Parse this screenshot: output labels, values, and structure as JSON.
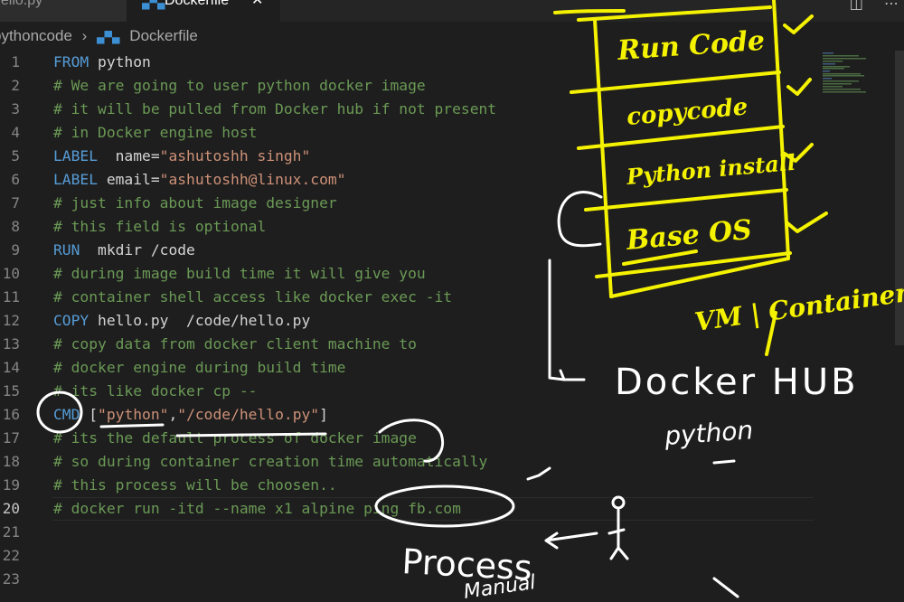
{
  "tabs": [
    {
      "label": "hello.py"
    },
    {
      "label": "Dockerfile",
      "close": "✕"
    }
  ],
  "breadcrumb": {
    "folder": "pythoncode",
    "separator": "›",
    "file": "Dockerfile"
  },
  "editor": {
    "active_line": "20",
    "lines": [
      {
        "n": "1",
        "segs": [
          {
            "t": "FROM",
            "c": "kw"
          },
          {
            "t": " python",
            "c": ""
          }
        ]
      },
      {
        "n": "2",
        "segs": [
          {
            "t": "# We are going to user python docker image",
            "c": "cm"
          }
        ]
      },
      {
        "n": "3",
        "segs": [
          {
            "t": "# it will be pulled from Docker hub if not present",
            "c": "cm"
          }
        ]
      },
      {
        "n": "4",
        "segs": [
          {
            "t": "# in Docker engine host",
            "c": "cm"
          }
        ]
      },
      {
        "n": "5",
        "segs": [
          {
            "t": "LABEL",
            "c": "kw"
          },
          {
            "t": "  name=",
            "c": ""
          },
          {
            "t": "\"ashutoshh singh\"",
            "c": "st"
          }
        ]
      },
      {
        "n": "6",
        "segs": [
          {
            "t": "LABEL",
            "c": "kw"
          },
          {
            "t": " email=",
            "c": ""
          },
          {
            "t": "\"ashutoshh@linux.com\"",
            "c": "st"
          }
        ]
      },
      {
        "n": "7",
        "segs": [
          {
            "t": "# just info about image designer",
            "c": "cm"
          }
        ]
      },
      {
        "n": "8",
        "segs": [
          {
            "t": "# this field is optional",
            "c": "cm"
          }
        ]
      },
      {
        "n": "9",
        "segs": [
          {
            "t": "RUN",
            "c": "kw"
          },
          {
            "t": "  mkdir /code",
            "c": ""
          }
        ]
      },
      {
        "n": "10",
        "segs": [
          {
            "t": "# during image build time it will give you",
            "c": "cm"
          }
        ]
      },
      {
        "n": "11",
        "segs": [
          {
            "t": "# container shell access like docker exec -it",
            "c": "cm"
          }
        ]
      },
      {
        "n": "12",
        "segs": [
          {
            "t": "COPY",
            "c": "kw"
          },
          {
            "t": " hello.py  /code/hello.py",
            "c": ""
          }
        ]
      },
      {
        "n": "13",
        "segs": [
          {
            "t": "# copy data from docker client machine to",
            "c": "cm"
          }
        ]
      },
      {
        "n": "14",
        "segs": [
          {
            "t": "# docker engine during build time",
            "c": "cm"
          }
        ]
      },
      {
        "n": "15",
        "segs": [
          {
            "t": "# its like docker cp --",
            "c": "cm"
          }
        ]
      },
      {
        "n": "16",
        "segs": [
          {
            "t": "CMD",
            "c": "kw"
          },
          {
            "t": " [",
            "c": ""
          },
          {
            "t": "\"python\"",
            "c": "st"
          },
          {
            "t": ",",
            "c": ""
          },
          {
            "t": "\"/code/hello.py\"",
            "c": "st"
          },
          {
            "t": "]",
            "c": ""
          }
        ]
      },
      {
        "n": "17",
        "segs": [
          {
            "t": "# its the default process of docker image",
            "c": "cm"
          }
        ]
      },
      {
        "n": "18",
        "segs": [
          {
            "t": "# so during container creation time automatically",
            "c": "cm"
          }
        ]
      },
      {
        "n": "19",
        "segs": [
          {
            "t": "# this process will be choosen..",
            "c": "cm"
          }
        ]
      },
      {
        "n": "20",
        "segs": [
          {
            "t": "# docker run -itd --name x1 alpine ping fb.com",
            "c": "cm"
          }
        ]
      },
      {
        "n": "21",
        "segs": []
      },
      {
        "n": "22",
        "segs": []
      },
      {
        "n": "23",
        "segs": []
      }
    ]
  },
  "annotations": {
    "layers": [
      "Run Code",
      "copycode",
      "Python install",
      "Base OS"
    ],
    "vm_container": "VM | Container",
    "docker_hub": "Docker HUB",
    "python": "python",
    "process": "Process",
    "process_sub": "Manual"
  },
  "colors": {
    "ink_yellow": "#f5f200",
    "ink_white": "#ffffff",
    "keyword": "#569cd6",
    "comment": "#6a9955",
    "string": "#ce9178"
  }
}
